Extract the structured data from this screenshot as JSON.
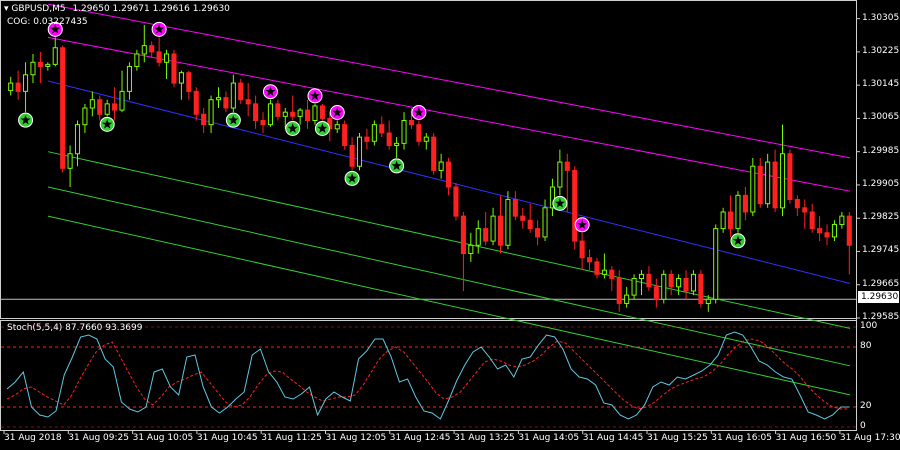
{
  "header": {
    "symbol_tf": "GBPUSD,M5",
    "ohlc": "1.29650 1.29671 1.29616 1.29630",
    "indicator": "COG: 0.03227435"
  },
  "stoch": {
    "label": "Stoch(5,5,4) 87.7660 93.3699",
    "levels": [
      "100",
      "80",
      "20",
      "0"
    ],
    "main_values": [
      38,
      45,
      55,
      20,
      12,
      10,
      16,
      52,
      70,
      90,
      92,
      88,
      68,
      60,
      25,
      18,
      15,
      20,
      55,
      58,
      40,
      32,
      70,
      72,
      40,
      20,
      14,
      20,
      28,
      35,
      72,
      78,
      55,
      45,
      30,
      28,
      33,
      40,
      12,
      28,
      35,
      30,
      26,
      68,
      76,
      88,
      88,
      70,
      45,
      48,
      30,
      16,
      14,
      8,
      26,
      46,
      62,
      75,
      80,
      70,
      58,
      62,
      50,
      68,
      70,
      82,
      92,
      90,
      78,
      58,
      50,
      48,
      42,
      24,
      22,
      12,
      8,
      12,
      22,
      40,
      45,
      42,
      50,
      48,
      52,
      56,
      62,
      72,
      92,
      95,
      92,
      80,
      66,
      62,
      55,
      50,
      48,
      32,
      15,
      12,
      8,
      12,
      20,
      20
    ],
    "signal_values": [
      28,
      32,
      38,
      40,
      35,
      30,
      26,
      22,
      32,
      48,
      62,
      75,
      82,
      85,
      70,
      55,
      40,
      28,
      22,
      30,
      40,
      45,
      48,
      52,
      55,
      45,
      35,
      25,
      20,
      22,
      30,
      42,
      52,
      56,
      55,
      48,
      42,
      35,
      30,
      26,
      28,
      30,
      30,
      32,
      42,
      55,
      68,
      76,
      80,
      75,
      65,
      55,
      45,
      34,
      28,
      30,
      35,
      45,
      55,
      65,
      68,
      66,
      62,
      60,
      62,
      66,
      72,
      80,
      86,
      84,
      76,
      68,
      60,
      52,
      44,
      36,
      28,
      22,
      18,
      20,
      25,
      32,
      38,
      42,
      45,
      48,
      50,
      55,
      62,
      72,
      80,
      86,
      88,
      86,
      80,
      72,
      64,
      58,
      50,
      40,
      32,
      25,
      20,
      18,
      18
    ]
  },
  "price_scale": [
    "1.30305",
    "1.30225",
    "1.30145",
    "1.30065",
    "1.29985",
    "1.29905",
    "1.29825",
    "1.29745",
    "1.29665",
    "1.29585"
  ],
  "current_price": "1.29630",
  "time_labels": [
    "31 Aug 2018",
    "31 Aug 09:25",
    "31 Aug 10:05",
    "31 Aug 10:45",
    "31 Aug 11:25",
    "31 Aug 12:05",
    "31 Aug 12:45",
    "31 Aug 13:25",
    "31 Aug 14:05",
    "31 Aug 14:45",
    "31 Aug 15:25",
    "31 Aug 16:05",
    "31 Aug 16:50",
    "31 Aug 17:30"
  ],
  "colors": {
    "background": "#000000",
    "bull": "#7CFC00",
    "bear": "#FF2020",
    "cog_upper": "#FF00FF",
    "cog_middle": "#3030FF",
    "cog_lower": "#32CD32",
    "stoch_main": "#5FC8E0",
    "stoch_signal": "#FF2020",
    "star_buy": "#32CD32",
    "star_sell": "#FF00FF"
  },
  "chart_data": {
    "type": "candlestick",
    "timeframe": "M5",
    "candles": [
      {
        "o": 1.30132,
        "h": 1.30165,
        "l": 1.3012,
        "c": 1.3015
      },
      {
        "o": 1.3015,
        "h": 1.3018,
        "l": 1.3011,
        "c": 1.3013
      },
      {
        "o": 1.3013,
        "h": 1.302,
        "l": 1.3008,
        "c": 1.3017
      },
      {
        "o": 1.3017,
        "h": 1.3022,
        "l": 1.3015,
        "c": 1.302
      },
      {
        "o": 1.302,
        "h": 1.30225,
        "l": 1.3015,
        "c": 1.3019
      },
      {
        "o": 1.3019,
        "h": 1.302,
        "l": 1.3018,
        "c": 1.30195
      },
      {
        "o": 1.30195,
        "h": 1.3026,
        "l": 1.3019,
        "c": 1.30235
      },
      {
        "o": 1.30235,
        "h": 1.3024,
        "l": 1.29935,
        "c": 1.29945
      },
      {
        "o": 1.29945,
        "h": 1.3,
        "l": 1.299,
        "c": 1.2998
      },
      {
        "o": 1.2998,
        "h": 1.3006,
        "l": 1.2995,
        "c": 1.3005
      },
      {
        "o": 1.3005,
        "h": 1.301,
        "l": 1.3003,
        "c": 1.3009
      },
      {
        "o": 1.3009,
        "h": 1.3013,
        "l": 1.3007,
        "c": 1.3011
      },
      {
        "o": 1.3011,
        "h": 1.3012,
        "l": 1.3006,
        "c": 1.30075
      },
      {
        "o": 1.30075,
        "h": 1.3011,
        "l": 1.3007,
        "c": 1.301
      },
      {
        "o": 1.301,
        "h": 1.3014,
        "l": 1.3006,
        "c": 1.30085
      },
      {
        "o": 1.30085,
        "h": 1.3018,
        "l": 1.3008,
        "c": 1.3013
      },
      {
        "o": 1.3013,
        "h": 1.302,
        "l": 1.3011,
        "c": 1.3019
      },
      {
        "o": 1.3019,
        "h": 1.3023,
        "l": 1.3018,
        "c": 1.3022
      },
      {
        "o": 1.3022,
        "h": 1.3029,
        "l": 1.302,
        "c": 1.3024
      },
      {
        "o": 1.3024,
        "h": 1.3025,
        "l": 1.3021,
        "c": 1.30225
      },
      {
        "o": 1.30225,
        "h": 1.3026,
        "l": 1.3019,
        "c": 1.302
      },
      {
        "o": 1.302,
        "h": 1.3023,
        "l": 1.3016,
        "c": 1.3022
      },
      {
        "o": 1.3022,
        "h": 1.3023,
        "l": 1.3014,
        "c": 1.3015
      },
      {
        "o": 1.3015,
        "h": 1.3018,
        "l": 1.3011,
        "c": 1.30175
      },
      {
        "o": 1.30175,
        "h": 1.3018,
        "l": 1.3011,
        "c": 1.3013
      },
      {
        "o": 1.3013,
        "h": 1.3014,
        "l": 1.3006,
        "c": 1.30075
      },
      {
        "o": 1.30075,
        "h": 1.3009,
        "l": 1.3003,
        "c": 1.3005
      },
      {
        "o": 1.3005,
        "h": 1.3012,
        "l": 1.3003,
        "c": 1.3011
      },
      {
        "o": 1.3011,
        "h": 1.3014,
        "l": 1.3009,
        "c": 1.30115
      },
      {
        "o": 1.30115,
        "h": 1.3013,
        "l": 1.3008,
        "c": 1.3009
      },
      {
        "o": 1.3009,
        "h": 1.3017,
        "l": 1.3008,
        "c": 1.3015
      },
      {
        "o": 1.3015,
        "h": 1.3016,
        "l": 1.301,
        "c": 1.3011
      },
      {
        "o": 1.3011,
        "h": 1.3015,
        "l": 1.3007,
        "c": 1.301
      },
      {
        "o": 1.301,
        "h": 1.3012,
        "l": 1.3004,
        "c": 1.3006
      },
      {
        "o": 1.3006,
        "h": 1.3008,
        "l": 1.3003,
        "c": 1.3005
      },
      {
        "o": 1.3005,
        "h": 1.3011,
        "l": 1.30045,
        "c": 1.301
      },
      {
        "o": 1.301,
        "h": 1.3011,
        "l": 1.3006,
        "c": 1.3007
      },
      {
        "o": 1.3007,
        "h": 1.3009,
        "l": 1.3004,
        "c": 1.3008
      },
      {
        "o": 1.3008,
        "h": 1.3012,
        "l": 1.3006,
        "c": 1.3007
      },
      {
        "o": 1.3007,
        "h": 1.3009,
        "l": 1.3005,
        "c": 1.30085
      },
      {
        "o": 1.30085,
        "h": 1.3011,
        "l": 1.3004,
        "c": 1.3006
      },
      {
        "o": 1.3006,
        "h": 1.301,
        "l": 1.3005,
        "c": 1.30095
      },
      {
        "o": 1.30095,
        "h": 1.301,
        "l": 1.3006,
        "c": 1.30065
      },
      {
        "o": 1.30065,
        "h": 1.3008,
        "l": 1.3001,
        "c": 1.3004
      },
      {
        "o": 1.3004,
        "h": 1.3006,
        "l": 1.3003,
        "c": 1.3005
      },
      {
        "o": 1.3005,
        "h": 1.3006,
        "l": 1.2999,
        "c": 1.3
      },
      {
        "o": 1.3,
        "h": 1.3002,
        "l": 1.2994,
        "c": 1.2995
      },
      {
        "o": 1.2995,
        "h": 1.3003,
        "l": 1.2994,
        "c": 1.3002
      },
      {
        "o": 1.3002,
        "h": 1.3004,
        "l": 1.2999,
        "c": 1.3001
      },
      {
        "o": 1.3001,
        "h": 1.3006,
        "l": 1.3,
        "c": 1.3005
      },
      {
        "o": 1.3005,
        "h": 1.3007,
        "l": 1.3002,
        "c": 1.3003
      },
      {
        "o": 1.3003,
        "h": 1.3006,
        "l": 1.2999,
        "c": 1.3
      },
      {
        "o": 1.3,
        "h": 1.3002,
        "l": 1.2997,
        "c": 1.30005
      },
      {
        "o": 1.30005,
        "h": 1.3008,
        "l": 1.2999,
        "c": 1.3006
      },
      {
        "o": 1.3006,
        "h": 1.3009,
        "l": 1.3004,
        "c": 1.3005
      },
      {
        "o": 1.3005,
        "h": 1.3006,
        "l": 1.3,
        "c": 1.3001
      },
      {
        "o": 1.3001,
        "h": 1.3003,
        "l": 1.2999,
        "c": 1.3002
      },
      {
        "o": 1.3002,
        "h": 1.3003,
        "l": 1.2993,
        "c": 1.2994
      },
      {
        "o": 1.2994,
        "h": 1.2998,
        "l": 1.2992,
        "c": 1.2996
      },
      {
        "o": 1.2996,
        "h": 1.2997,
        "l": 1.2988,
        "c": 1.299
      },
      {
        "o": 1.299,
        "h": 1.2991,
        "l": 1.2982,
        "c": 1.2983
      },
      {
        "o": 1.2983,
        "h": 1.2984,
        "l": 1.2965,
        "c": 1.2974
      },
      {
        "o": 1.2974,
        "h": 1.2979,
        "l": 1.2972,
        "c": 1.2976
      },
      {
        "o": 1.2976,
        "h": 1.2982,
        "l": 1.2974,
        "c": 1.298
      },
      {
        "o": 1.298,
        "h": 1.2984,
        "l": 1.2976,
        "c": 1.2977
      },
      {
        "o": 1.2977,
        "h": 1.2985,
        "l": 1.2976,
        "c": 1.2983
      },
      {
        "o": 1.2983,
        "h": 1.2988,
        "l": 1.2974,
        "c": 1.2976
      },
      {
        "o": 1.2976,
        "h": 1.2989,
        "l": 1.2975,
        "c": 1.2987
      },
      {
        "o": 1.2987,
        "h": 1.2989,
        "l": 1.2982,
        "c": 1.2983
      },
      {
        "o": 1.2983,
        "h": 1.2985,
        "l": 1.298,
        "c": 1.2982
      },
      {
        "o": 1.2982,
        "h": 1.2986,
        "l": 1.2979,
        "c": 1.298
      },
      {
        "o": 1.298,
        "h": 1.2982,
        "l": 1.2976,
        "c": 1.2978
      },
      {
        "o": 1.2978,
        "h": 1.2987,
        "l": 1.2977,
        "c": 1.2985
      },
      {
        "o": 1.2985,
        "h": 1.2992,
        "l": 1.2983,
        "c": 1.299
      },
      {
        "o": 1.299,
        "h": 1.2999,
        "l": 1.2988,
        "c": 1.2996
      },
      {
        "o": 1.2996,
        "h": 1.2998,
        "l": 1.2984,
        "c": 1.2994
      },
      {
        "o": 1.2994,
        "h": 1.2995,
        "l": 1.2975,
        "c": 1.2977
      },
      {
        "o": 1.2977,
        "h": 1.2979,
        "l": 1.297,
        "c": 1.2973
      },
      {
        "o": 1.2973,
        "h": 1.2975,
        "l": 1.297,
        "c": 1.2972
      },
      {
        "o": 1.2972,
        "h": 1.2973,
        "l": 1.2968,
        "c": 1.2969
      },
      {
        "o": 1.2969,
        "h": 1.2974,
        "l": 1.2968,
        "c": 1.297
      },
      {
        "o": 1.297,
        "h": 1.2971,
        "l": 1.2965,
        "c": 1.2968
      },
      {
        "o": 1.2968,
        "h": 1.297,
        "l": 1.296,
        "c": 1.2962
      },
      {
        "o": 1.2962,
        "h": 1.2966,
        "l": 1.2961,
        "c": 1.2964
      },
      {
        "o": 1.2964,
        "h": 1.2969,
        "l": 1.2963,
        "c": 1.2968
      },
      {
        "o": 1.2968,
        "h": 1.297,
        "l": 1.2964,
        "c": 1.2969
      },
      {
        "o": 1.2969,
        "h": 1.2971,
        "l": 1.2965,
        "c": 1.2966
      },
      {
        "o": 1.2966,
        "h": 1.2968,
        "l": 1.2961,
        "c": 1.2963
      },
      {
        "o": 1.2963,
        "h": 1.297,
        "l": 1.2962,
        "c": 1.2969
      },
      {
        "o": 1.2969,
        "h": 1.297,
        "l": 1.2964,
        "c": 1.2966
      },
      {
        "o": 1.2966,
        "h": 1.2969,
        "l": 1.2964,
        "c": 1.2968
      },
      {
        "o": 1.2968,
        "h": 1.297,
        "l": 1.2963,
        "c": 1.2965
      },
      {
        "o": 1.2965,
        "h": 1.297,
        "l": 1.2964,
        "c": 1.2969
      },
      {
        "o": 1.2969,
        "h": 1.297,
        "l": 1.2961,
        "c": 1.2962
      },
      {
        "o": 1.2962,
        "h": 1.2964,
        "l": 1.296,
        "c": 1.2963
      },
      {
        "o": 1.2963,
        "h": 1.2981,
        "l": 1.2962,
        "c": 1.298
      },
      {
        "o": 1.298,
        "h": 1.2985,
        "l": 1.2979,
        "c": 1.2984
      },
      {
        "o": 1.2984,
        "h": 1.2988,
        "l": 1.2978,
        "c": 1.298
      },
      {
        "o": 1.298,
        "h": 1.2989,
        "l": 1.2979,
        "c": 1.2988
      },
      {
        "o": 1.2988,
        "h": 1.299,
        "l": 1.2982,
        "c": 1.2984
      },
      {
        "o": 1.2984,
        "h": 1.2997,
        "l": 1.2983,
        "c": 1.2995
      },
      {
        "o": 1.2995,
        "h": 1.2997,
        "l": 1.2985,
        "c": 1.2986
      },
      {
        "o": 1.2986,
        "h": 1.2998,
        "l": 1.2985,
        "c": 1.2996
      },
      {
        "o": 1.2996,
        "h": 1.2999,
        "l": 1.2984,
        "c": 1.2985
      },
      {
        "o": 1.2985,
        "h": 1.3005,
        "l": 1.2983,
        "c": 1.2998
      },
      {
        "o": 1.2998,
        "h": 1.2999,
        "l": 1.2986,
        "c": 1.2987
      },
      {
        "o": 1.2987,
        "h": 1.2988,
        "l": 1.2983,
        "c": 1.2985
      },
      {
        "o": 1.2985,
        "h": 1.2987,
        "l": 1.298,
        "c": 1.2984
      },
      {
        "o": 1.2984,
        "h": 1.2986,
        "l": 1.2979,
        "c": 1.298
      },
      {
        "o": 1.298,
        "h": 1.2983,
        "l": 1.2977,
        "c": 1.2979
      },
      {
        "o": 1.2979,
        "h": 1.2981,
        "l": 1.2976,
        "c": 1.2978
      },
      {
        "o": 1.2978,
        "h": 1.2982,
        "l": 1.2977,
        "c": 1.2981
      },
      {
        "o": 1.2981,
        "h": 1.2984,
        "l": 1.298,
        "c": 1.2983
      },
      {
        "o": 1.2983,
        "h": 1.2984,
        "l": 1.2969,
        "c": 1.2976
      }
    ],
    "cog_lines": {
      "upper2": [
        [
          1.3034,
          1.2997
        ]
      ],
      "upper1": [
        [
          1.3026,
          1.2989
        ]
      ],
      "middle": [
        [
          1.30155,
          1.29668
        ]
      ],
      "lower1": [
        [
          1.29985,
          1.2956
        ]
      ],
      "lower2": [
        [
          1.299,
          1.2947
        ]
      ],
      "lower3": [
        [
          1.2983,
          1.294
        ]
      ]
    },
    "sell_arrows": [
      6,
      20,
      35,
      41,
      44,
      55,
      77
    ],
    "buy_arrows": [
      2,
      13,
      30,
      38,
      42,
      46,
      52,
      74,
      98
    ],
    "ylim": [
      1.29585,
      1.30345
    ],
    "x_labels": [
      "31 Aug 2018",
      "31 Aug 09:25",
      "31 Aug 10:05",
      "31 Aug 10:45",
      "31 Aug 11:25",
      "31 Aug 12:05",
      "31 Aug 12:45",
      "31 Aug 13:25",
      "31 Aug 14:05",
      "31 Aug 14:45",
      "31 Aug 15:25",
      "31 Aug 16:05",
      "31 Aug 16:50",
      "31 Aug 17:30"
    ]
  }
}
